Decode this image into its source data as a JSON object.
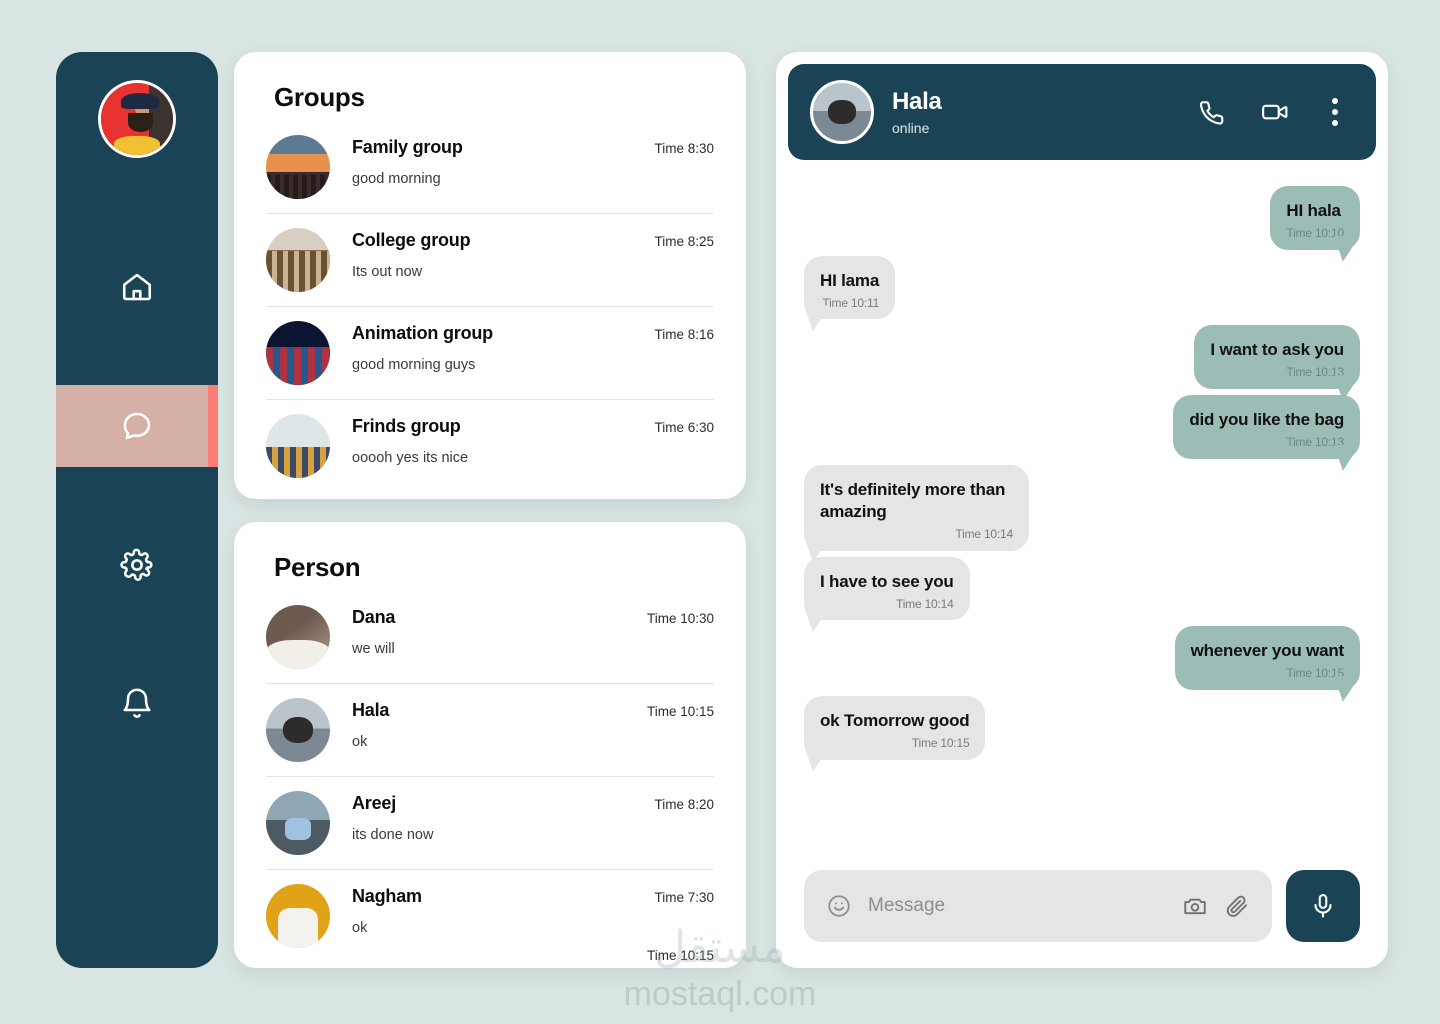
{
  "theme": {
    "page_background": "#d9e5e3",
    "sidebar": "#1a4355",
    "accent_active_bg": "#d4b0a6",
    "accent_bar": "#fc7e79",
    "bubble_out": "#9cbdb6",
    "bubble_in": "#e5e5e5",
    "card": "#ffffff"
  },
  "sidebar": {
    "profile_avatar": "user-avatar",
    "items": [
      {
        "icon": "home-icon",
        "name": "home",
        "active": false
      },
      {
        "icon": "chat-bubble-icon",
        "name": "chats",
        "active": true
      },
      {
        "icon": "gear-icon",
        "name": "settings",
        "active": false
      },
      {
        "icon": "bell-icon",
        "name": "notifications",
        "active": false
      }
    ]
  },
  "groups": {
    "title": "Groups",
    "items": [
      {
        "name": "Family group",
        "message": "good morning",
        "time": "Time 8:30",
        "avatar": "av-family"
      },
      {
        "name": "College group",
        "message": "Its out now",
        "time": "Time 8:25",
        "avatar": "av-college"
      },
      {
        "name": "Animation group",
        "message": "good morning guys",
        "time": "Time 8:16",
        "avatar": "av-anim"
      },
      {
        "name": "Frinds group",
        "message": "ooooh yes its nice",
        "time": "Time 6:30",
        "avatar": "av-frinds"
      }
    ]
  },
  "person": {
    "title": "Person",
    "items": [
      {
        "name": "Dana",
        "message": "we will",
        "time": "Time 10:30",
        "avatar": "av-dana"
      },
      {
        "name": "Hala",
        "message": "ok",
        "time": "Time 10:15",
        "avatar": "av-hala"
      },
      {
        "name": "Areej",
        "message": "its done now",
        "time": "Time 8:20",
        "avatar": "av-areej"
      },
      {
        "name": "Nagham",
        "message": "ok",
        "time": "Time 7:30",
        "avatar": "av-nagham",
        "extra_time": "Time 10:15"
      }
    ]
  },
  "chat": {
    "contact_name": "Hala",
    "status": "online",
    "avatar": "contact-avatar",
    "actions": [
      "phone-icon",
      "video-camera-icon",
      "more-options-icon"
    ],
    "messages": [
      {
        "side": "out",
        "text": "HI hala",
        "time": "Time 10:10"
      },
      {
        "side": "in",
        "text": "HI lama",
        "time": "Time 10:11"
      },
      {
        "side": "out",
        "text": "I want to ask you",
        "time": "Time 10:13"
      },
      {
        "side": "out",
        "text": "did you like the bag",
        "time": "Time 10:13"
      },
      {
        "side": "in",
        "text": "It's definitely more than amazing",
        "time": "Time 10:14"
      },
      {
        "side": "in",
        "text": "I have to see you",
        "time": "Time 10:14"
      },
      {
        "side": "out",
        "text": "whenever you want",
        "time": "Time 10:15"
      },
      {
        "side": "in",
        "text": "ok Tomorrow good",
        "time": "Time 10:15"
      }
    ],
    "composer": {
      "placeholder": "Message",
      "value": "",
      "emoji_icon": "smiley-icon",
      "camera_icon": "camera-icon",
      "attach_icon": "paperclip-icon",
      "mic_icon": "microphone-icon"
    }
  },
  "watermark": {
    "arabic": "مستقل",
    "latin": "mostaql.com"
  }
}
